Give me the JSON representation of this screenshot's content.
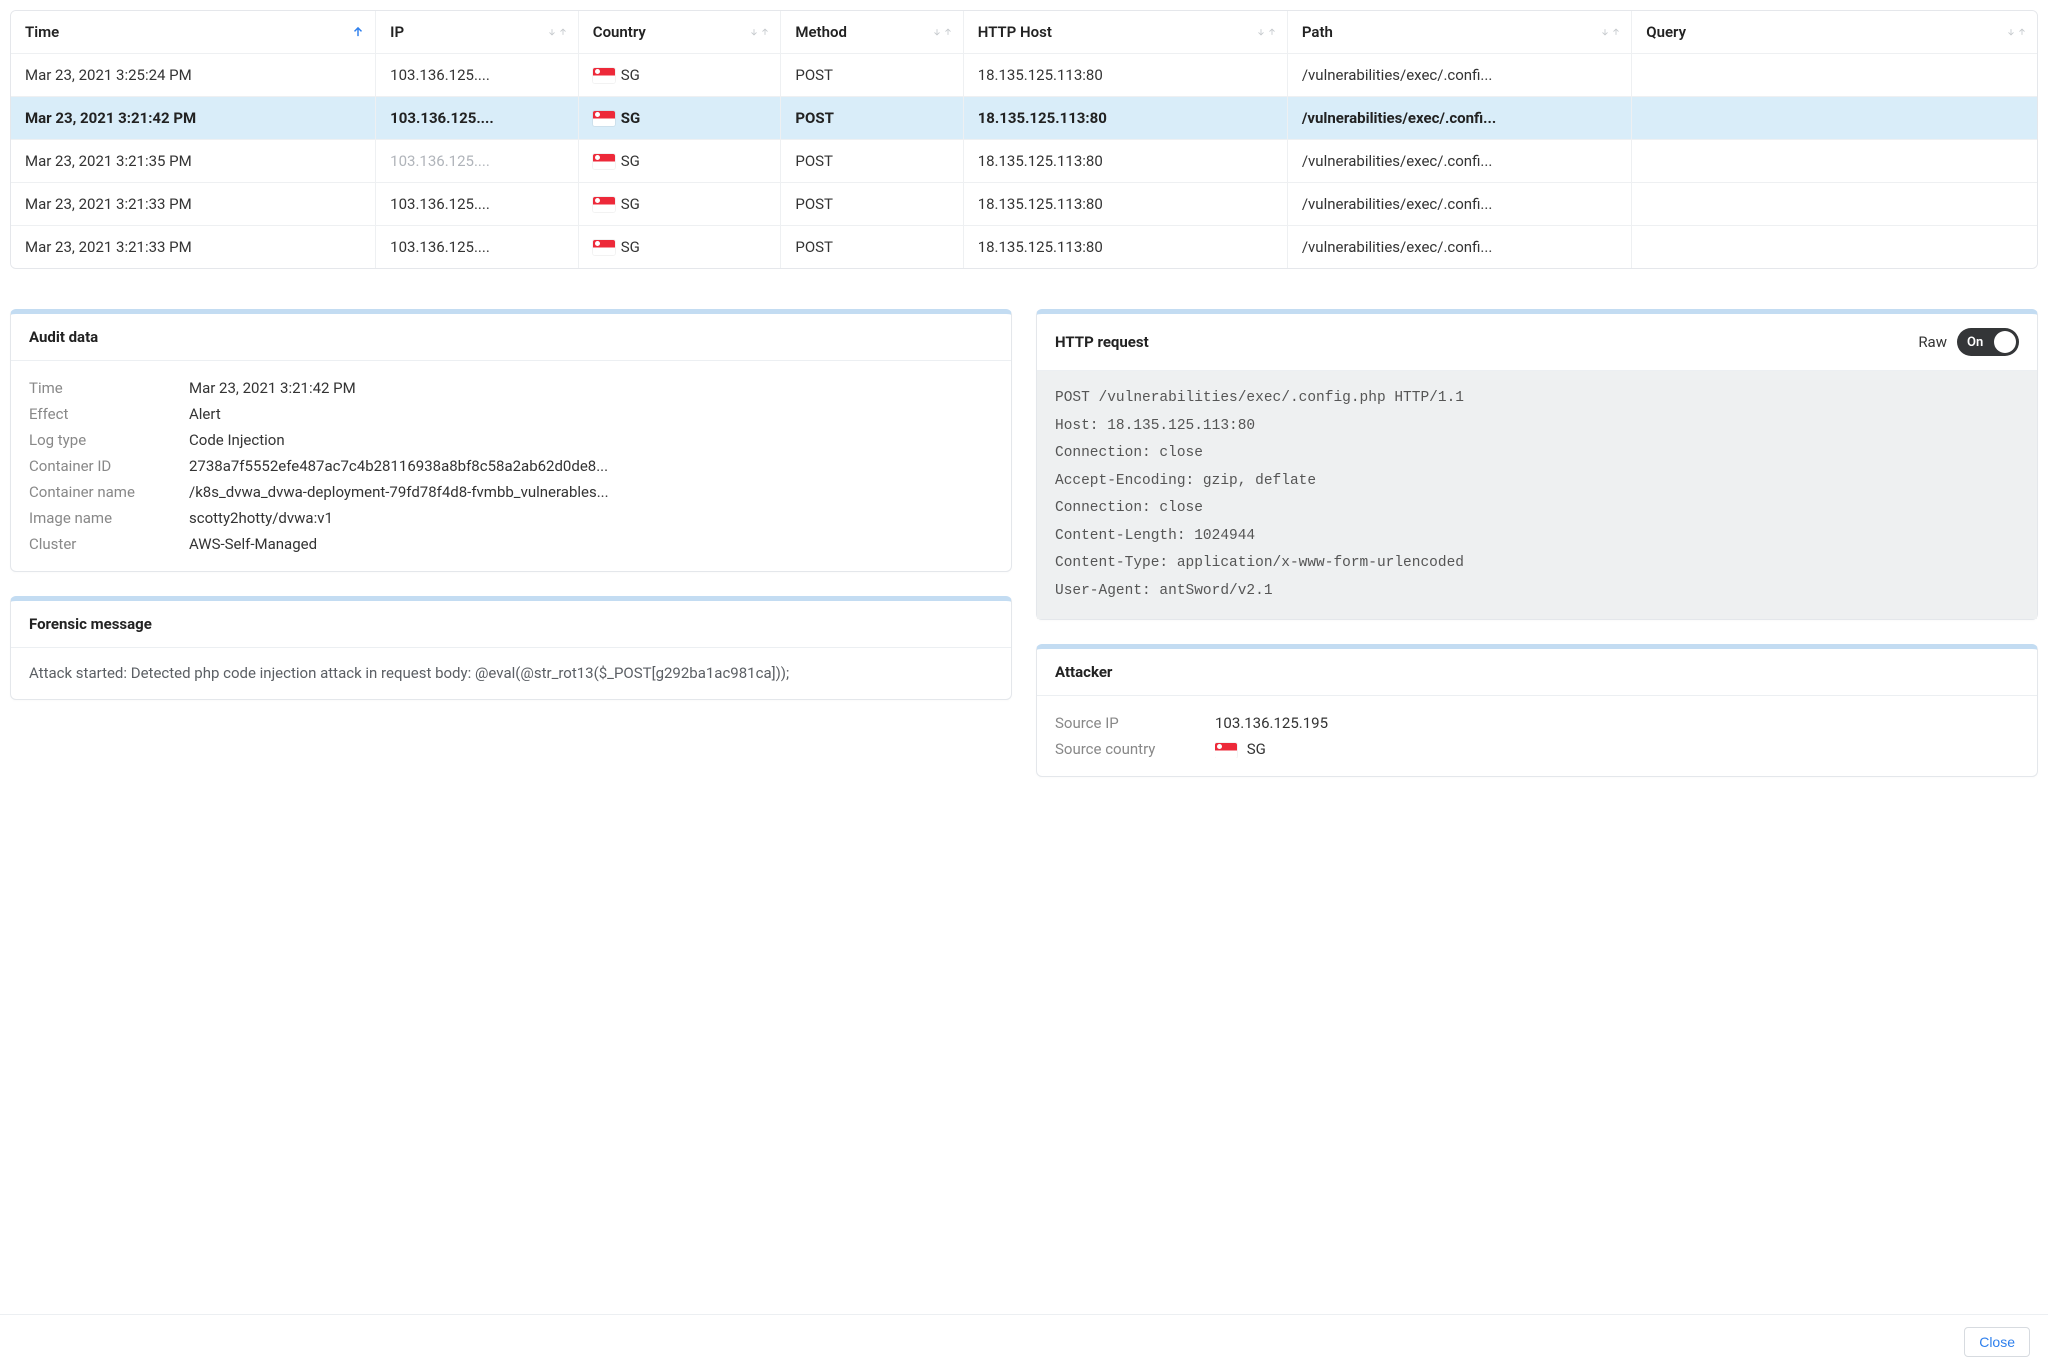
{
  "table": {
    "columns": [
      {
        "key": "time",
        "label": "Time",
        "sort": "asc-active",
        "width": "18%"
      },
      {
        "key": "ip",
        "label": "IP",
        "sort": "both",
        "width": "10%"
      },
      {
        "key": "country",
        "label": "Country",
        "sort": "both",
        "width": "10%"
      },
      {
        "key": "method",
        "label": "Method",
        "sort": "both",
        "width": "9%"
      },
      {
        "key": "host",
        "label": "HTTP Host",
        "sort": "both",
        "width": "16%"
      },
      {
        "key": "path",
        "label": "Path",
        "sort": "both",
        "width": "17%"
      },
      {
        "key": "query",
        "label": "Query",
        "sort": "both",
        "width": "20%"
      }
    ],
    "rows": [
      {
        "time": "Mar 23, 2021 3:25:24 PM",
        "ip": "103.136.125....",
        "country": "SG",
        "method": "POST",
        "host": "18.135.125.113:80",
        "path": "/vulnerabilities/exec/.confi...",
        "query": "",
        "selected": false,
        "muted": false
      },
      {
        "time": "Mar 23, 2021 3:21:42 PM",
        "ip": "103.136.125....",
        "country": "SG",
        "method": "POST",
        "host": "18.135.125.113:80",
        "path": "/vulnerabilities/exec/.confi...",
        "query": "",
        "selected": true,
        "muted": false
      },
      {
        "time": "Mar 23, 2021 3:21:35 PM",
        "ip": "103.136.125....",
        "country": "SG",
        "method": "POST",
        "host": "18.135.125.113:80",
        "path": "/vulnerabilities/exec/.confi...",
        "query": "",
        "selected": false,
        "muted": true
      },
      {
        "time": "Mar 23, 2021 3:21:33 PM",
        "ip": "103.136.125....",
        "country": "SG",
        "method": "POST",
        "host": "18.135.125.113:80",
        "path": "/vulnerabilities/exec/.confi...",
        "query": "",
        "selected": false,
        "muted": false
      },
      {
        "time": "Mar 23, 2021 3:21:33 PM",
        "ip": "103.136.125....",
        "country": "SG",
        "method": "POST",
        "host": "18.135.125.113:80",
        "path": "/vulnerabilities/exec/.confi...",
        "query": "",
        "selected": false,
        "muted": false
      }
    ]
  },
  "audit": {
    "title": "Audit data",
    "fields": [
      {
        "key": "Time",
        "val": "Mar 23, 2021 3:21:42 PM"
      },
      {
        "key": "Effect",
        "val": "Alert"
      },
      {
        "key": "Log type",
        "val": "Code Injection"
      },
      {
        "key": "Container ID",
        "val": "2738a7f5552efe487ac7c4b28116938a8bf8c58a2ab62d0de8..."
      },
      {
        "key": "Container name",
        "val": "/k8s_dvwa_dvwa-deployment-79fd78f4d8-fvmbb_vulnerables..."
      },
      {
        "key": "Image name",
        "val": "scotty2hotty/dvwa:v1"
      },
      {
        "key": "Cluster",
        "val": "AWS-Self-Managed"
      }
    ]
  },
  "http": {
    "title": "HTTP request",
    "raw_label": "Raw",
    "toggle_state": "On",
    "raw": "POST /vulnerabilities/exec/.config.php HTTP/1.1\nHost: 18.135.125.113:80\nConnection: close\nAccept-Encoding: gzip, deflate\nConnection: close\nContent-Length: 1024944\nContent-Type: application/x-www-form-urlencoded\nUser-Agent: antSword/v2.1"
  },
  "forensic": {
    "title": "Forensic message",
    "message": "Attack started: Detected php code injection attack in request body: @eval(@str_rot13($_POST[g292ba1ac981ca]));"
  },
  "attacker": {
    "title": "Attacker",
    "fields": [
      {
        "key": "Source IP",
        "val": "103.136.125.195",
        "flag": false
      },
      {
        "key": "Source country",
        "val": "SG",
        "flag": true
      }
    ]
  },
  "footer": {
    "close": "Close"
  }
}
